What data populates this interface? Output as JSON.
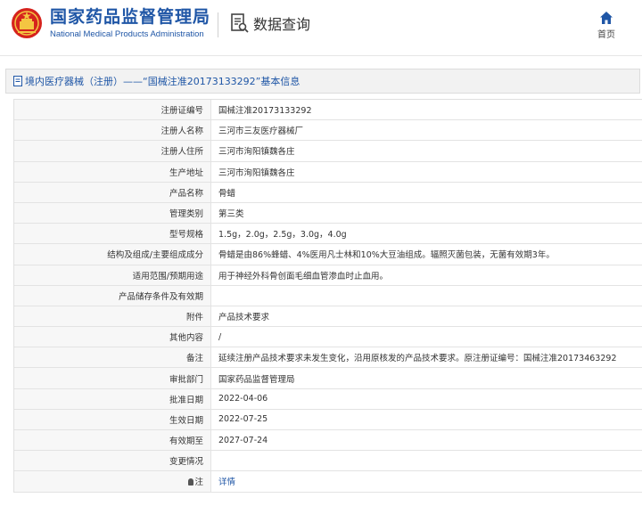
{
  "header": {
    "brand_cn": "国家药品监督管理局",
    "brand_en": "National Medical Products Administration",
    "query_label": "数据查询",
    "home_label": "首页",
    "brand_color": "#1f56a6",
    "emblem_color": "#d6231d"
  },
  "section": {
    "title": "境内医疗器械（注册）——“国械注准20173133292”基本信息"
  },
  "rows": [
    {
      "label": "注册证编号",
      "value": "国械注准20173133292"
    },
    {
      "label": "注册人名称",
      "value": "三河市三友医疗器械厂"
    },
    {
      "label": "注册人住所",
      "value": "三河市洵阳镇魏各庄"
    },
    {
      "label": "生产地址",
      "value": "三河市洵阳镇魏各庄"
    },
    {
      "label": "产品名称",
      "value": "骨蜡"
    },
    {
      "label": "管理类别",
      "value": "第三类"
    },
    {
      "label": "型号规格",
      "value": "1.5g，2.0g，2.5g，3.0g，4.0g"
    },
    {
      "label": "结构及组成/主要组成成分",
      "value": "骨蜡是由86%蜂蜡、4%医用凡士林和10%大豆油组成。辐照灭菌包装，无菌有效期3年。"
    },
    {
      "label": "适用范围/预期用途",
      "value": "用于神经外科骨创面毛细血管渗血时止血用。"
    },
    {
      "label": "产品储存条件及有效期",
      "value": ""
    },
    {
      "label": "附件",
      "value": "产品技术要求"
    },
    {
      "label": "其他内容",
      "value": "/"
    },
    {
      "label": "备注",
      "value": "延续注册产品技术要求未发生变化，沿用原核发的产品技术要求。原注册证编号：国械注准20173463292"
    },
    {
      "label": "审批部门",
      "value": "国家药品监督管理局"
    },
    {
      "label": "批准日期",
      "value": "2022-04-06"
    },
    {
      "label": "生效日期",
      "value": "2022-07-25"
    },
    {
      "label": "有效期至",
      "value": "2027-07-24"
    },
    {
      "label": "变更情况",
      "value": ""
    },
    {
      "label": "注",
      "value": "详情",
      "icon": "lightbulb-icon"
    }
  ]
}
